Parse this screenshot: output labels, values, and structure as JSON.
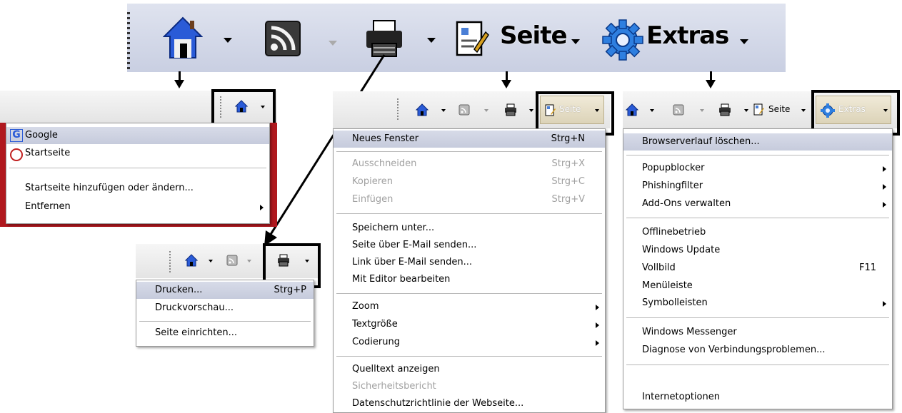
{
  "toolbar": {
    "page_label": "Seite",
    "tools_label": "Extras"
  },
  "home_menu": {
    "items": [
      {
        "label": "Google",
        "state": "selected"
      },
      {
        "label": "Startseite",
        "state": "normal"
      },
      {
        "label": "Startseite hinzufügen oder ändern...",
        "state": "normal"
      },
      {
        "label": "Entfernen",
        "state": "normal",
        "submenu": true
      }
    ]
  },
  "print_menu": {
    "items": [
      {
        "label": "Drucken...",
        "shortcut": "Strg+P",
        "state": "selected"
      },
      {
        "label": "Druckvorschau...",
        "state": "normal"
      },
      {
        "label": "Seite einrichten...",
        "state": "normal"
      }
    ]
  },
  "page_menu": {
    "button_label": "Seite",
    "items": [
      {
        "label": "Neues Fenster",
        "shortcut": "Strg+N",
        "state": "selected"
      },
      {
        "label": "Ausschneiden",
        "shortcut": "Strg+X",
        "state": "disabled"
      },
      {
        "label": "Kopieren",
        "shortcut": "Strg+C",
        "state": "disabled"
      },
      {
        "label": "Einfügen",
        "shortcut": "Strg+V",
        "state": "disabled"
      },
      {
        "label": "Speichern unter...",
        "state": "normal"
      },
      {
        "label": "Seite über E-Mail senden...",
        "state": "normal"
      },
      {
        "label": "Link über E-Mail senden...",
        "state": "normal"
      },
      {
        "label": "Mit Editor bearbeiten",
        "state": "normal"
      },
      {
        "label": "Zoom",
        "state": "normal",
        "submenu": true
      },
      {
        "label": "Textgröße",
        "state": "normal",
        "submenu": true
      },
      {
        "label": "Codierung",
        "state": "normal",
        "submenu": true
      },
      {
        "label": "Quelltext anzeigen",
        "state": "normal"
      },
      {
        "label": "Sicherheitsbericht",
        "state": "disabled"
      },
      {
        "label": "Datenschutzrichtlinie der Webseite...",
        "state": "normal"
      }
    ]
  },
  "tools_menu": {
    "page_label": "Seite",
    "button_label": "Extras",
    "items": [
      {
        "label": "Browserverlauf löschen...",
        "state": "selected"
      },
      {
        "label": "Popupblocker",
        "state": "normal",
        "submenu": true
      },
      {
        "label": "Phishingfilter",
        "state": "normal",
        "submenu": true
      },
      {
        "label": "Add-Ons verwalten",
        "state": "normal",
        "submenu": true
      },
      {
        "label": "Offlinebetrieb",
        "state": "normal"
      },
      {
        "label": "Windows Update",
        "state": "normal"
      },
      {
        "label": "Vollbild",
        "shortcut": "F11",
        "state": "normal"
      },
      {
        "label": "Menüleiste",
        "state": "normal"
      },
      {
        "label": "Symbolleisten",
        "state": "normal",
        "submenu": true
      },
      {
        "label": "Windows Messenger",
        "state": "normal"
      },
      {
        "label": "Diagnose von Verbindungsproblemen...",
        "state": "normal"
      },
      {
        "label": "Internetoptionen",
        "state": "normal"
      }
    ]
  },
  "colors": {
    "selection": "#c6cbdc",
    "highlight_box": "#000000",
    "home_blue": "#2a5bd7",
    "gear_blue": "#2e7fe0"
  },
  "icons": [
    "home-icon",
    "rss-feed-icon",
    "printer-icon",
    "page-icon",
    "gear-icon",
    "google-icon",
    "startseite-icon"
  ]
}
